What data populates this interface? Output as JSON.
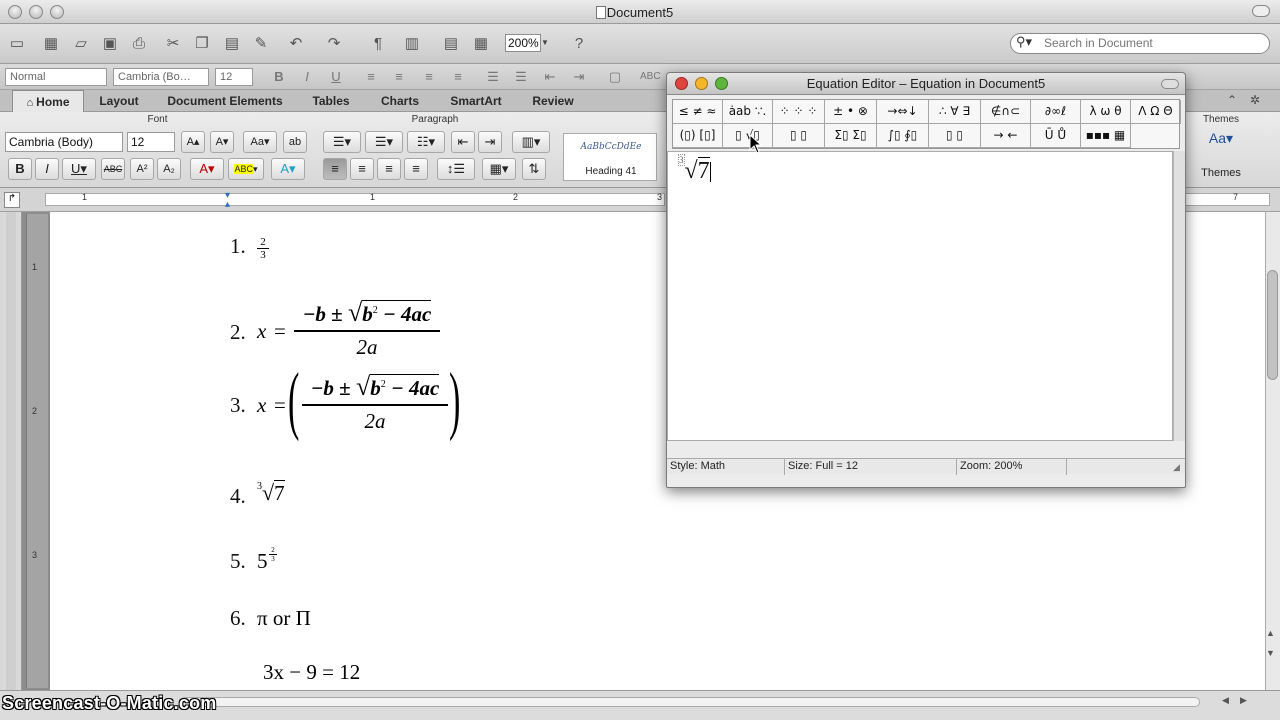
{
  "window": {
    "title": "Document5"
  },
  "toolbar": {
    "zoom_value": "200%",
    "search_placeholder": "Search in Document"
  },
  "formatbar": {
    "style": "Normal",
    "font": "Cambria (Bo…",
    "size": "12"
  },
  "ribbon": {
    "tabs": [
      {
        "label": "Home",
        "active": true
      },
      {
        "label": "Layout"
      },
      {
        "label": "Document Elements"
      },
      {
        "label": "Tables"
      },
      {
        "label": "Charts"
      },
      {
        "label": "SmartArt"
      },
      {
        "label": "Review"
      }
    ],
    "font_group_label": "Font",
    "paragraph_group_label": "Paragraph",
    "themes_group_label": "Themes",
    "font_name": "Cambria (Body)",
    "font_size": "12",
    "style_card_sample": "AaBbCcDdEe",
    "style_card_name": "Heading 41",
    "themes_button_label": "Themes"
  },
  "ruler": {
    "numbers": [
      "1",
      "1",
      "2",
      "3",
      "7"
    ]
  },
  "vruler": {
    "numbers": [
      "1",
      "2",
      "3"
    ]
  },
  "document": {
    "items": [
      {
        "label": "1."
      },
      {
        "label": "2.",
        "lhs": "x",
        "eq": "="
      },
      {
        "label": "3.",
        "lhs": "x",
        "eq": "="
      },
      {
        "label": "4.",
        "root_index": "3",
        "radicand": "7"
      },
      {
        "label": "5.",
        "base": "5",
        "exp_num": "2",
        "exp_den": "3"
      },
      {
        "label": "6.",
        "text": "π or Π"
      }
    ],
    "fraction": {
      "num": "2",
      "den": "3"
    },
    "quadratic": {
      "numerator": "−b ± ",
      "radicand_b": "b",
      "radicand_exp": "2",
      "radicand_rest": " − 4ac",
      "denominator": "2a"
    },
    "last_equation": {
      "lhs": "3x − 9",
      "eq": "=",
      "rhs": "12"
    }
  },
  "equation_editor": {
    "title": "Equation Editor – Equation in Document5",
    "palette_row1": [
      "≤ ≠ ≈",
      "ȧab ∵.",
      "⁘ ⁘ ⁘",
      "± • ⊗",
      "→⇔↓",
      "∴ ∀ ∃",
      "∉∩⊂",
      "∂∞ℓ",
      "λ ω θ",
      "Λ Ω Θ"
    ],
    "palette_row2": [
      "(▯) [▯]",
      "▯ √▯",
      "▯ ▯",
      "Σ▯ Σ▯",
      "∫▯ ∮▯",
      "▯ ▯",
      "→ ←",
      "Ū Ů",
      "▪▪▪ ▦"
    ],
    "content_index": "3",
    "content_radicand": "7",
    "status": {
      "style": "Style: Math",
      "size": "Size: Full = 12",
      "zoom": "Zoom: 200%"
    }
  },
  "watermark": "Screencast-O-Matic.com",
  "colors": {
    "close": "#e0443e",
    "minimize": "#f5b62c",
    "zoom": "#5db53b",
    "link_blue": "#3b5b8f"
  }
}
